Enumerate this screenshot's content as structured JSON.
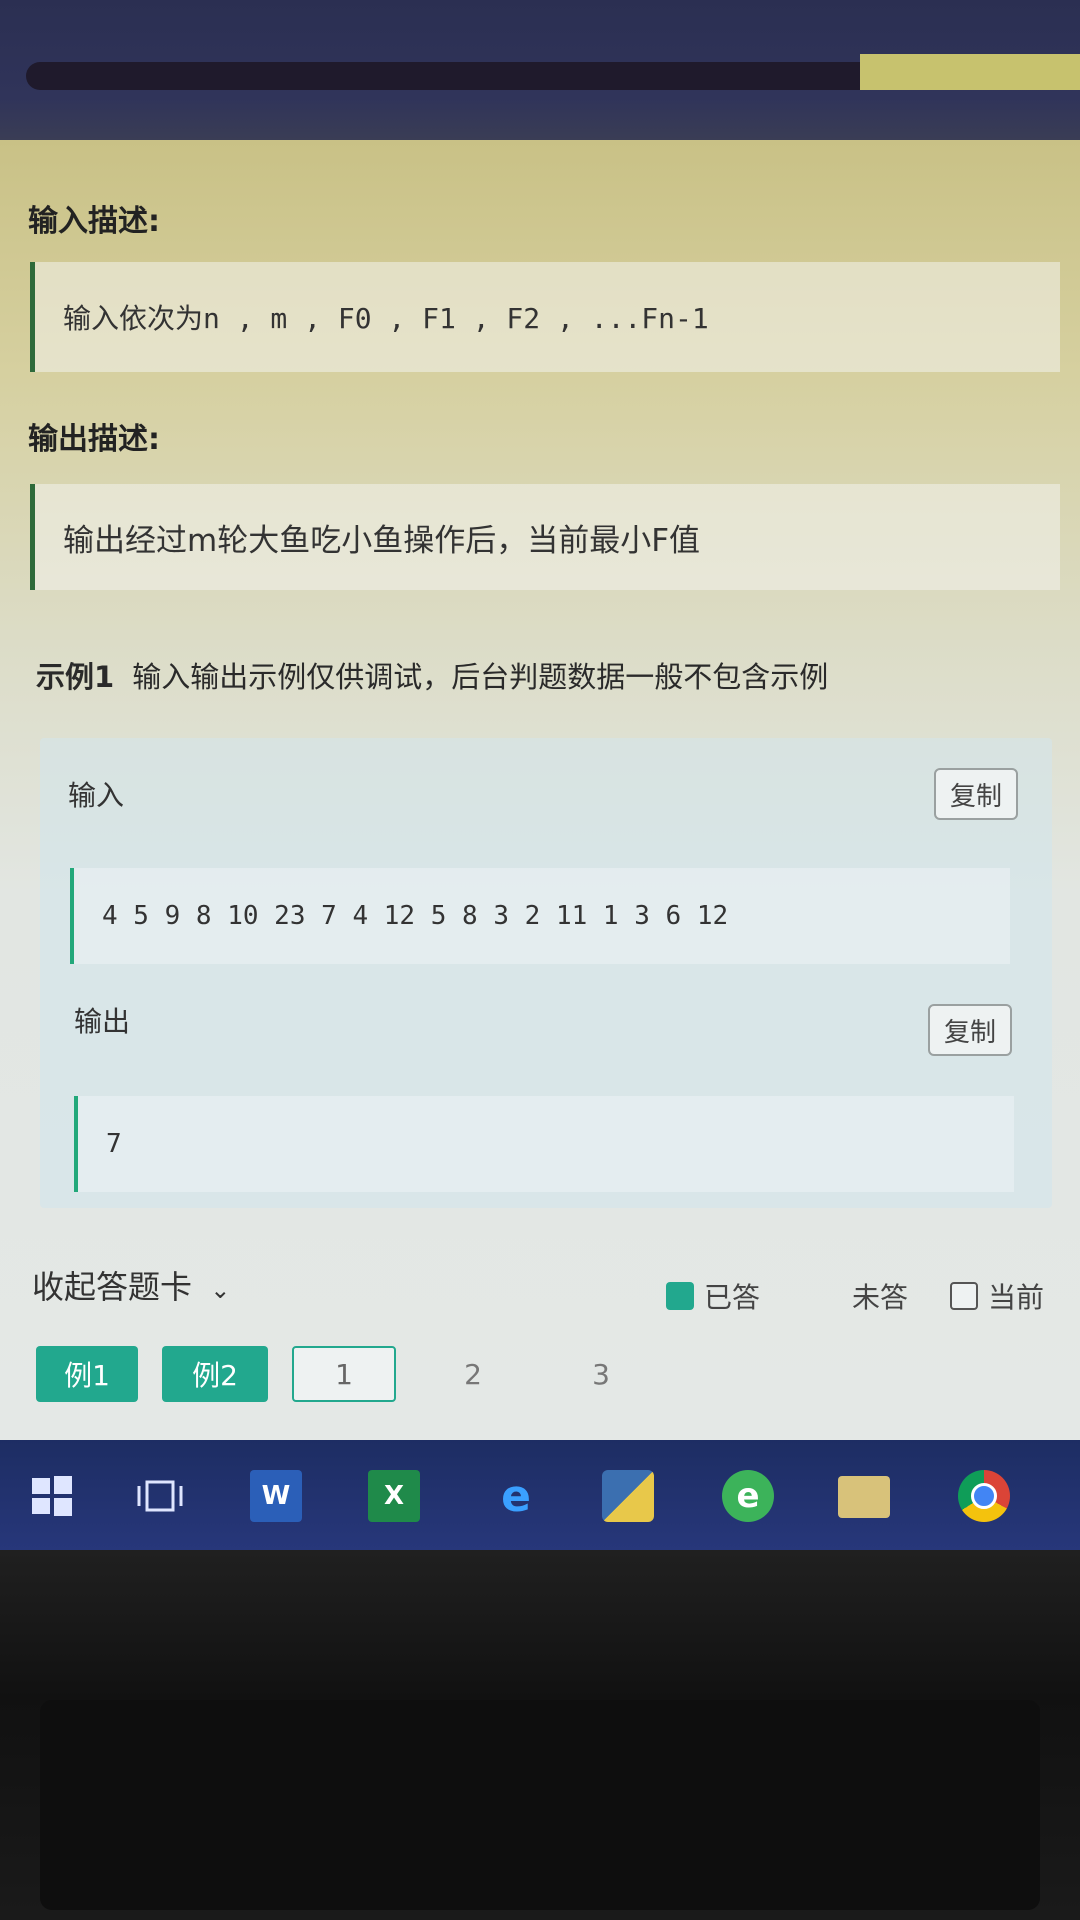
{
  "input_desc": {
    "title": "输入描述:",
    "text": "输入依次为n , m , F0 , F1 , F2 , ...Fn-1"
  },
  "output_desc": {
    "title": "输出描述:",
    "text": "输出经过m轮大鱼吃小鱼操作后，当前最小F值"
  },
  "example": {
    "label": "示例1",
    "note": "输入输出示例仅供调试，后台判题数据一般不包含示例",
    "input_label": "输入",
    "input_value": "4 5 9 8 10 23 7 4 12 5 8 3 2 11 1 3 6 12",
    "output_label": "输出",
    "output_value": "7",
    "copy_label": "复制"
  },
  "answer_card": {
    "collapse_label": "收起答题卡",
    "legend_answered": "已答",
    "legend_unanswered": "未答",
    "legend_current": "当前",
    "buttons": [
      "例1",
      "例2",
      "1",
      "2",
      "3"
    ]
  },
  "colors": {
    "accent": "#22a88e",
    "quote_border": "#2e6a3a"
  },
  "progress": {
    "fraction": 0.8
  },
  "taskbar": {
    "icons": [
      "windows-start-icon",
      "task-view-icon",
      "word-icon",
      "excel-icon",
      "edge-icon",
      "python-icon",
      "ie-icon",
      "file-explorer-icon",
      "chrome-icon"
    ]
  }
}
